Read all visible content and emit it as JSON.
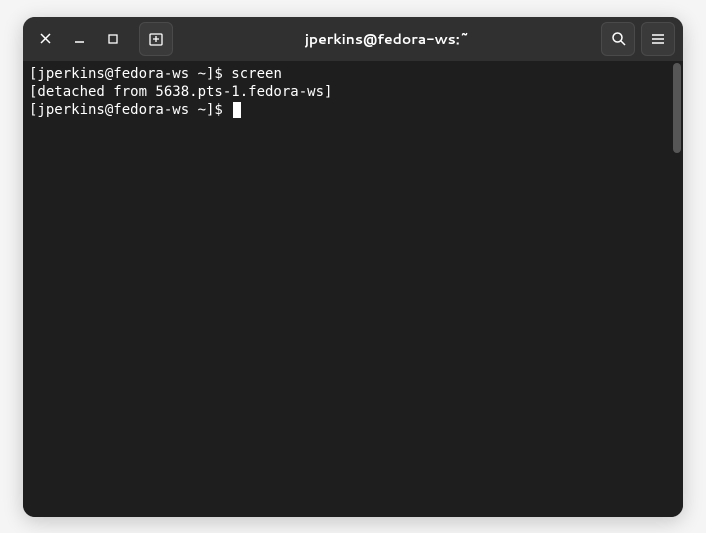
{
  "window": {
    "title": "jperkins@fedora-ws:~"
  },
  "terminal": {
    "lines": [
      {
        "prompt": "[jperkins@fedora-ws ~]$ ",
        "command": "screen"
      },
      {
        "text": "[detached from 5638.pts-1.fedora-ws]"
      },
      {
        "prompt": "[jperkins@fedora-ws ~]$ ",
        "command": "",
        "cursor": true
      }
    ]
  }
}
